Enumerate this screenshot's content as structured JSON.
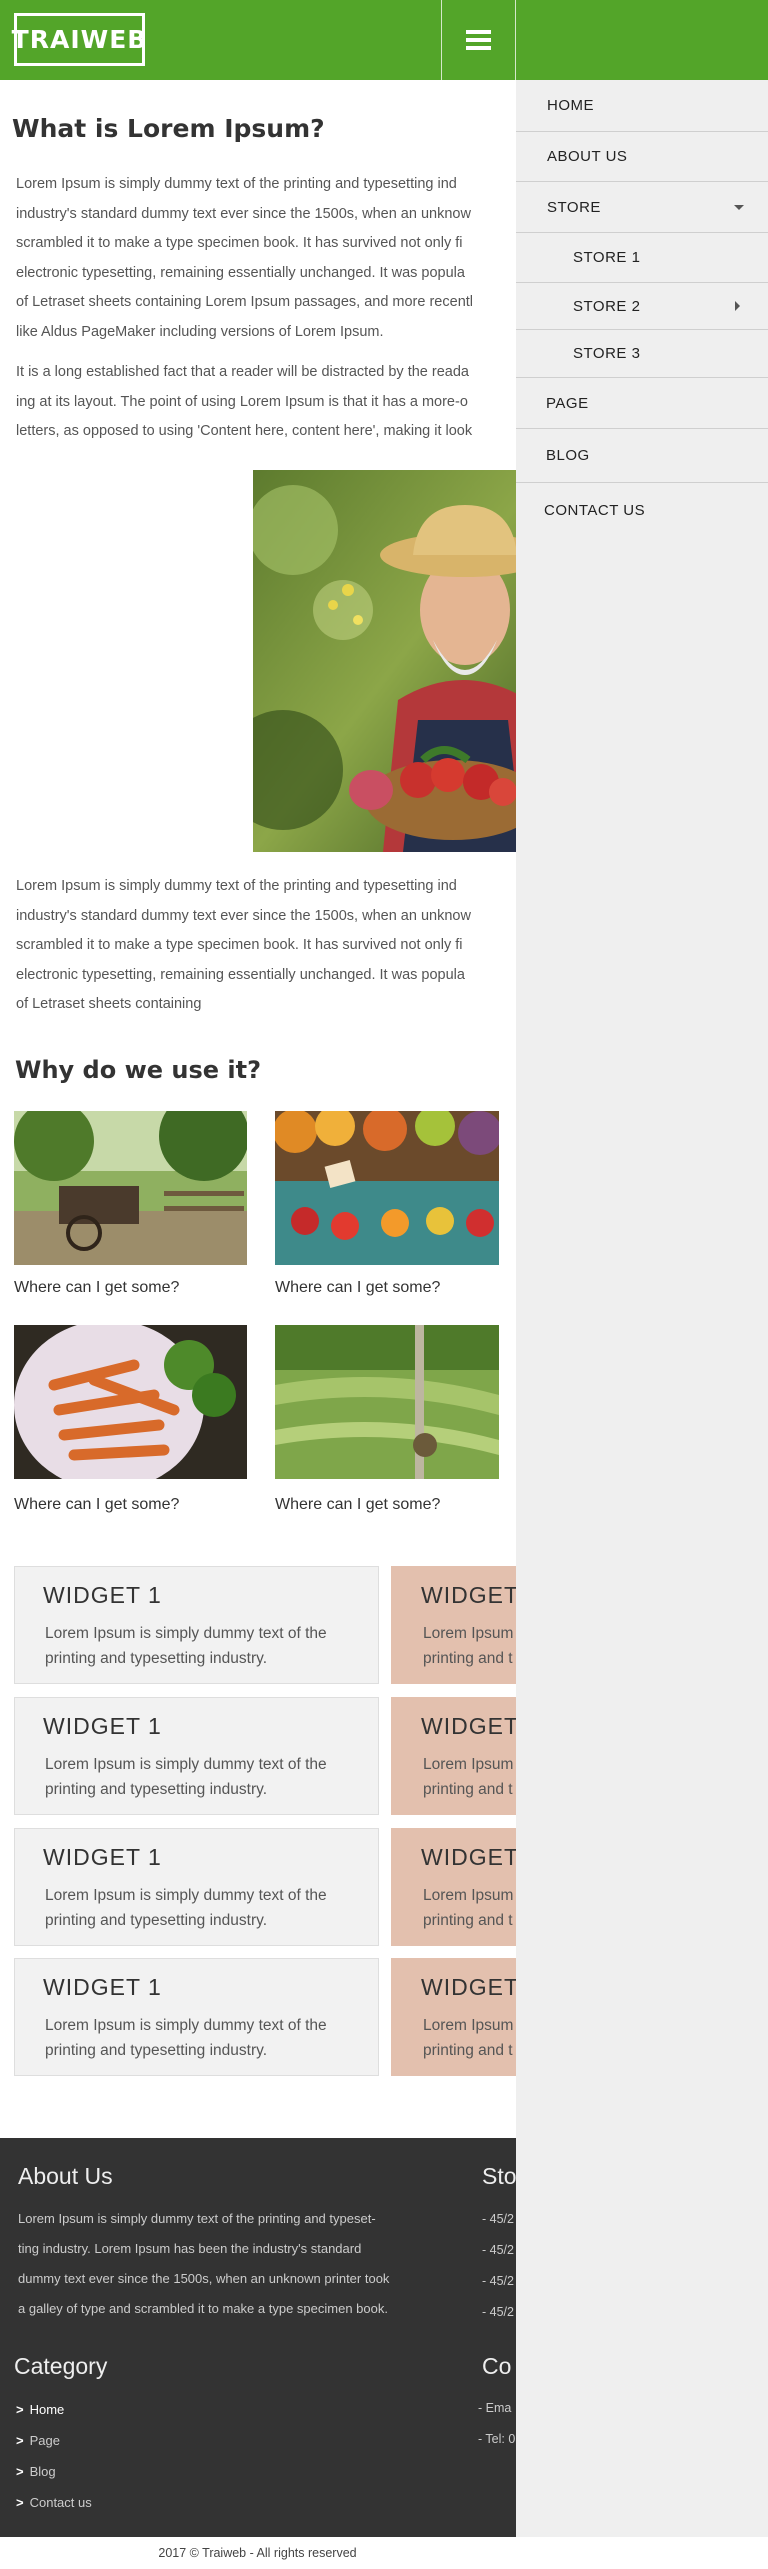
{
  "header": {
    "logo": "TRAIWEB",
    "menu_icon": "hamburger-menu-icon",
    "brand_color": "#53a529"
  },
  "article": {
    "title": "What is Lorem Ipsum?",
    "para1": [
      "Lorem Ipsum is simply dummy text of the printing and typesetting ind",
      "industry's standard dummy text ever since the 1500s, when an unknow",
      "scrambled it to make a type specimen book. It has survived not only fi",
      "electronic typesetting, remaining essentially unchanged. It was popula",
      "of Letraset sheets containing Lorem Ipsum passages, and more recentl",
      "like Aldus PageMaker including versions of Lorem Ipsum."
    ],
    "para2": [
      "It is a long established fact that a reader will be distracted by the reada",
      "ing at its layout. The point of using Lorem Ipsum is that it has a more-o",
      "letters, as opposed to using 'Content here, content here', making it look"
    ],
    "para3": [
      "Lorem Ipsum is simply dummy text of the printing and typesetting ind",
      "industry's standard dummy text ever since the 1500s, when an unknow",
      "scrambled it to make a type specimen book. It has survived not only fi",
      "electronic typesetting, remaining essentially unchanged. It was popula",
      "of Letraset sheets containing"
    ]
  },
  "why": {
    "title": "Why do we use it?",
    "items": [
      {
        "caption": "Where can I get some?"
      },
      {
        "caption": "Where can I get some?"
      },
      {
        "caption": "Where can I get some?"
      },
      {
        "caption": "Where can I get some?"
      }
    ]
  },
  "widgets": {
    "rows": [
      {
        "left_title": "WIDGET 1",
        "left_line1": "Lorem Ipsum is simply dummy text of the",
        "left_line2": "printing and typesetting industry.",
        "right_title": "WIDGET",
        "right_line1": "Lorem Ipsum",
        "right_line2": "printing and t"
      },
      {
        "left_title": "WIDGET 1",
        "left_line1": "Lorem Ipsum is simply dummy text of the",
        "left_line2": "printing and typesetting industry.",
        "right_title": "WIDGET",
        "right_line1": "Lorem Ipsum",
        "right_line2": "printing and t"
      },
      {
        "left_title": "WIDGET 1",
        "left_line1": "Lorem Ipsum is simply dummy text of the",
        "left_line2": "printing and typesetting industry.",
        "right_title": "WIDGET",
        "right_line1": "Lorem Ipsum",
        "right_line2": "printing and t"
      },
      {
        "left_title": "WIDGET 1",
        "left_line1": "Lorem Ipsum is simply dummy text of the",
        "left_line2": "printing and typesetting industry.",
        "right_title": "WIDGET",
        "right_line1": "Lorem Ipsum",
        "right_line2": "printing and t"
      }
    ],
    "right_color": "#e3c0ae"
  },
  "footer": {
    "about_title": "About Us",
    "about_lines": [
      "Lorem Ipsum is simply dummy text of the printing and typeset-",
      "ting industry. Lorem Ipsum has been the industry's standard",
      "dummy text ever since the 1500s, when an unknown printer took",
      "a galley of type and scrambled it to make a type specimen book."
    ],
    "store_title": "Sto",
    "store_lines": [
      "- 45/2",
      "- 45/2",
      "- 45/2",
      "- 45/2"
    ],
    "category_title": "Category",
    "category_marker": ">",
    "categories": [
      "Home",
      "Page",
      "Blog",
      "Contact us"
    ],
    "contact_title": "Co",
    "contact_lines": [
      "- Ema",
      "- Tel: 0"
    ],
    "copyright": "2017 © Traiweb - All rights reserved"
  },
  "sidemenu": {
    "home": "HOME",
    "about": "ABOUT US",
    "store": "STORE",
    "store1": "STORE 1",
    "store2": "STORE 2",
    "store3": "STORE 3",
    "page": "PAGE",
    "blog": "BLOG",
    "contact": "CONTACT US"
  }
}
